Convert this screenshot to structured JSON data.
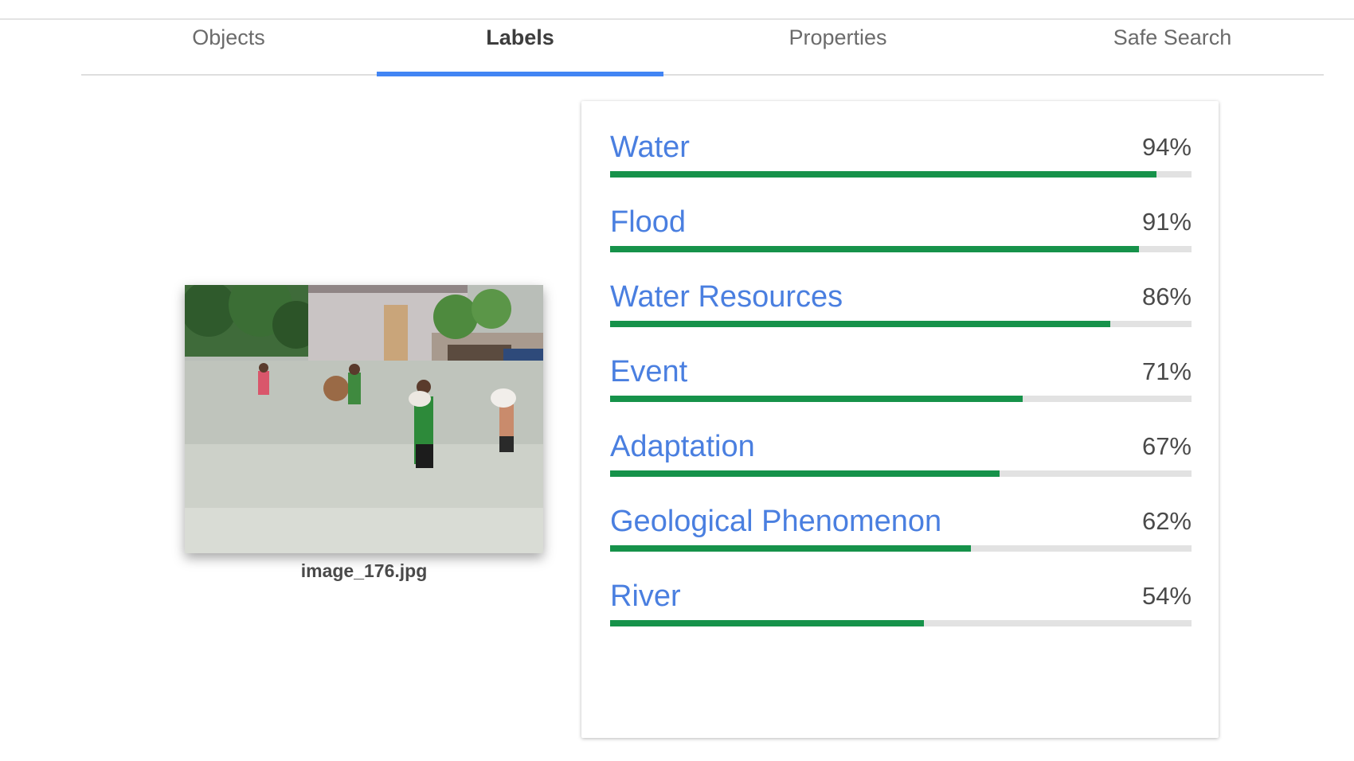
{
  "tabs": [
    {
      "label": "Objects",
      "active": false
    },
    {
      "label": "Labels",
      "active": true
    },
    {
      "label": "Properties",
      "active": false
    },
    {
      "label": "Safe Search",
      "active": false
    }
  ],
  "image": {
    "filename": "image_176.jpg"
  },
  "labels": [
    {
      "name": "Water",
      "score": "94%",
      "fraction": 0.94
    },
    {
      "name": "Flood",
      "score": "91%",
      "fraction": 0.91
    },
    {
      "name": "Water Resources",
      "score": "86%",
      "fraction": 0.86
    },
    {
      "name": "Event",
      "score": "71%",
      "fraction": 0.71
    },
    {
      "name": "Adaptation",
      "score": "67%",
      "fraction": 0.67
    },
    {
      "name": "Geological Phenomenon",
      "score": "62%",
      "fraction": 0.62
    },
    {
      "name": "River",
      "score": "54%",
      "fraction": 0.54
    }
  ],
  "colors": {
    "accent": "#4285f4",
    "label_text": "#4a7fe0",
    "bar_fill": "#16924a",
    "bar_track": "#e2e2e2"
  }
}
